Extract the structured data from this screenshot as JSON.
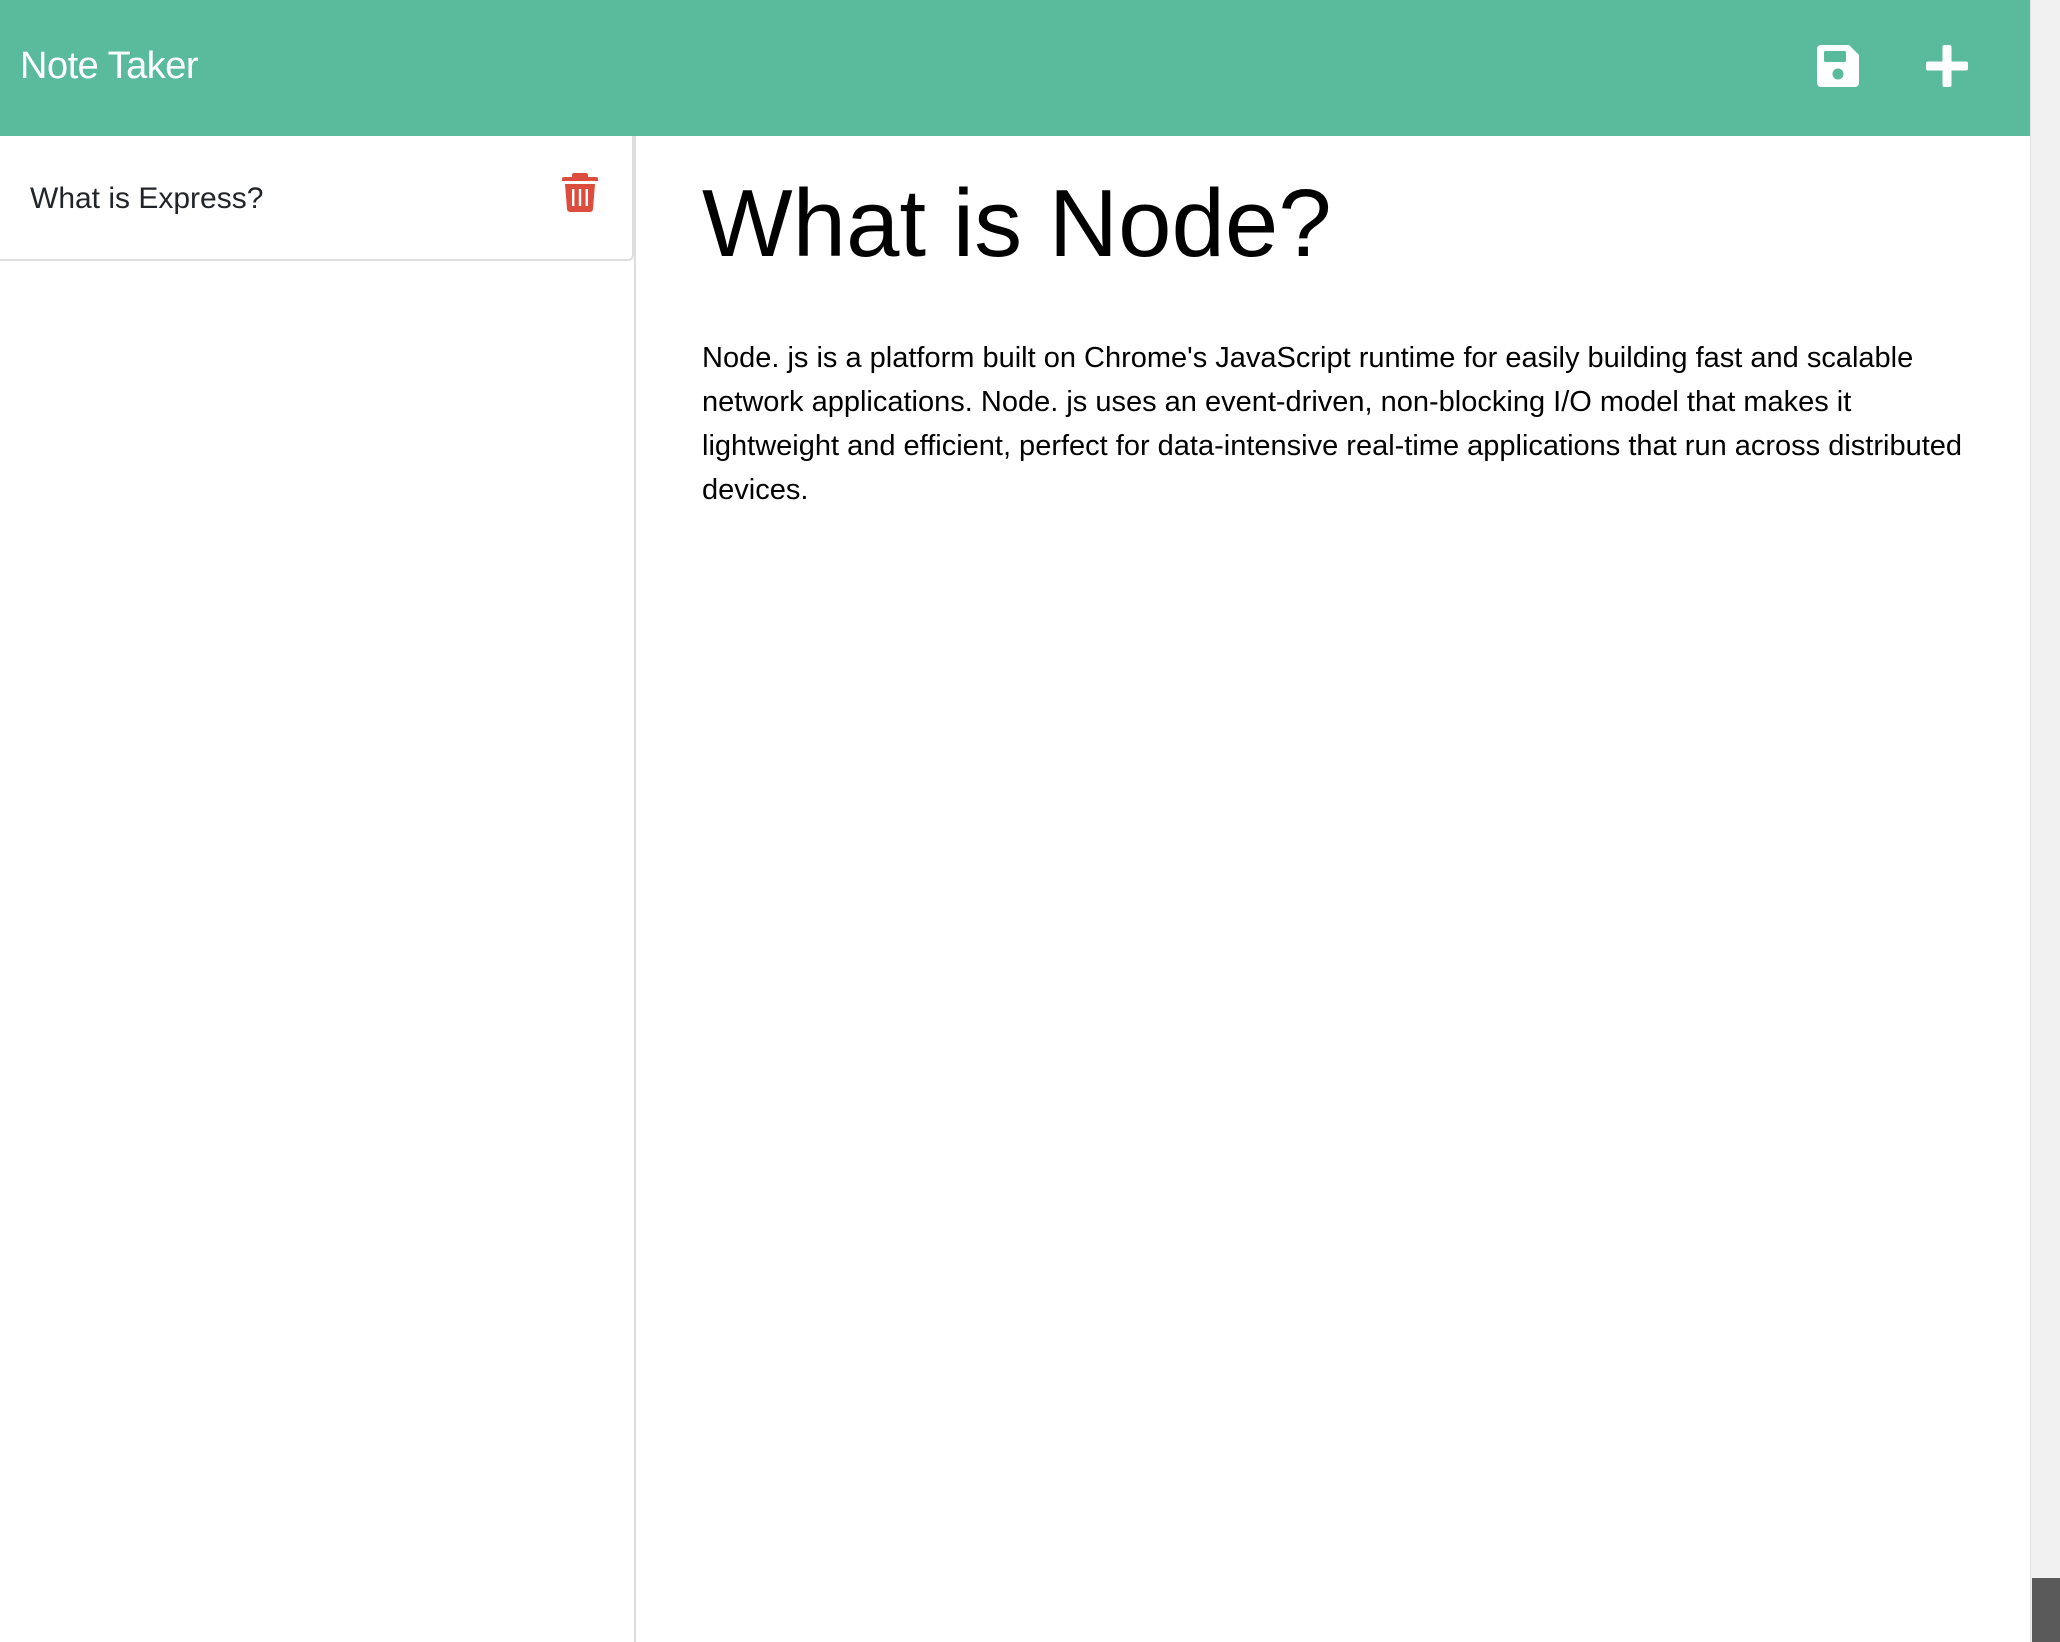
{
  "app": {
    "brand": "Note Taker"
  },
  "toolbar": {
    "save_icon": "floppy-disk-icon",
    "new_icon": "plus-icon",
    "icon_color": "#ffffff"
  },
  "colors": {
    "navbar": "#59bb9c",
    "delete": "#dc4d3e"
  },
  "sidebar": {
    "notes": [
      {
        "title": "What is Express?",
        "action_icon": "trash-icon"
      }
    ]
  },
  "editor": {
    "title": "What is Node?",
    "body": "Node. js is a platform built on Chrome's JavaScript runtime for easily building fast and scalable network applications. Node. js uses an event-driven, non-blocking I/O model that makes it lightweight and efficient, perfect for data-intensive real-time applications that run across distributed devices."
  }
}
